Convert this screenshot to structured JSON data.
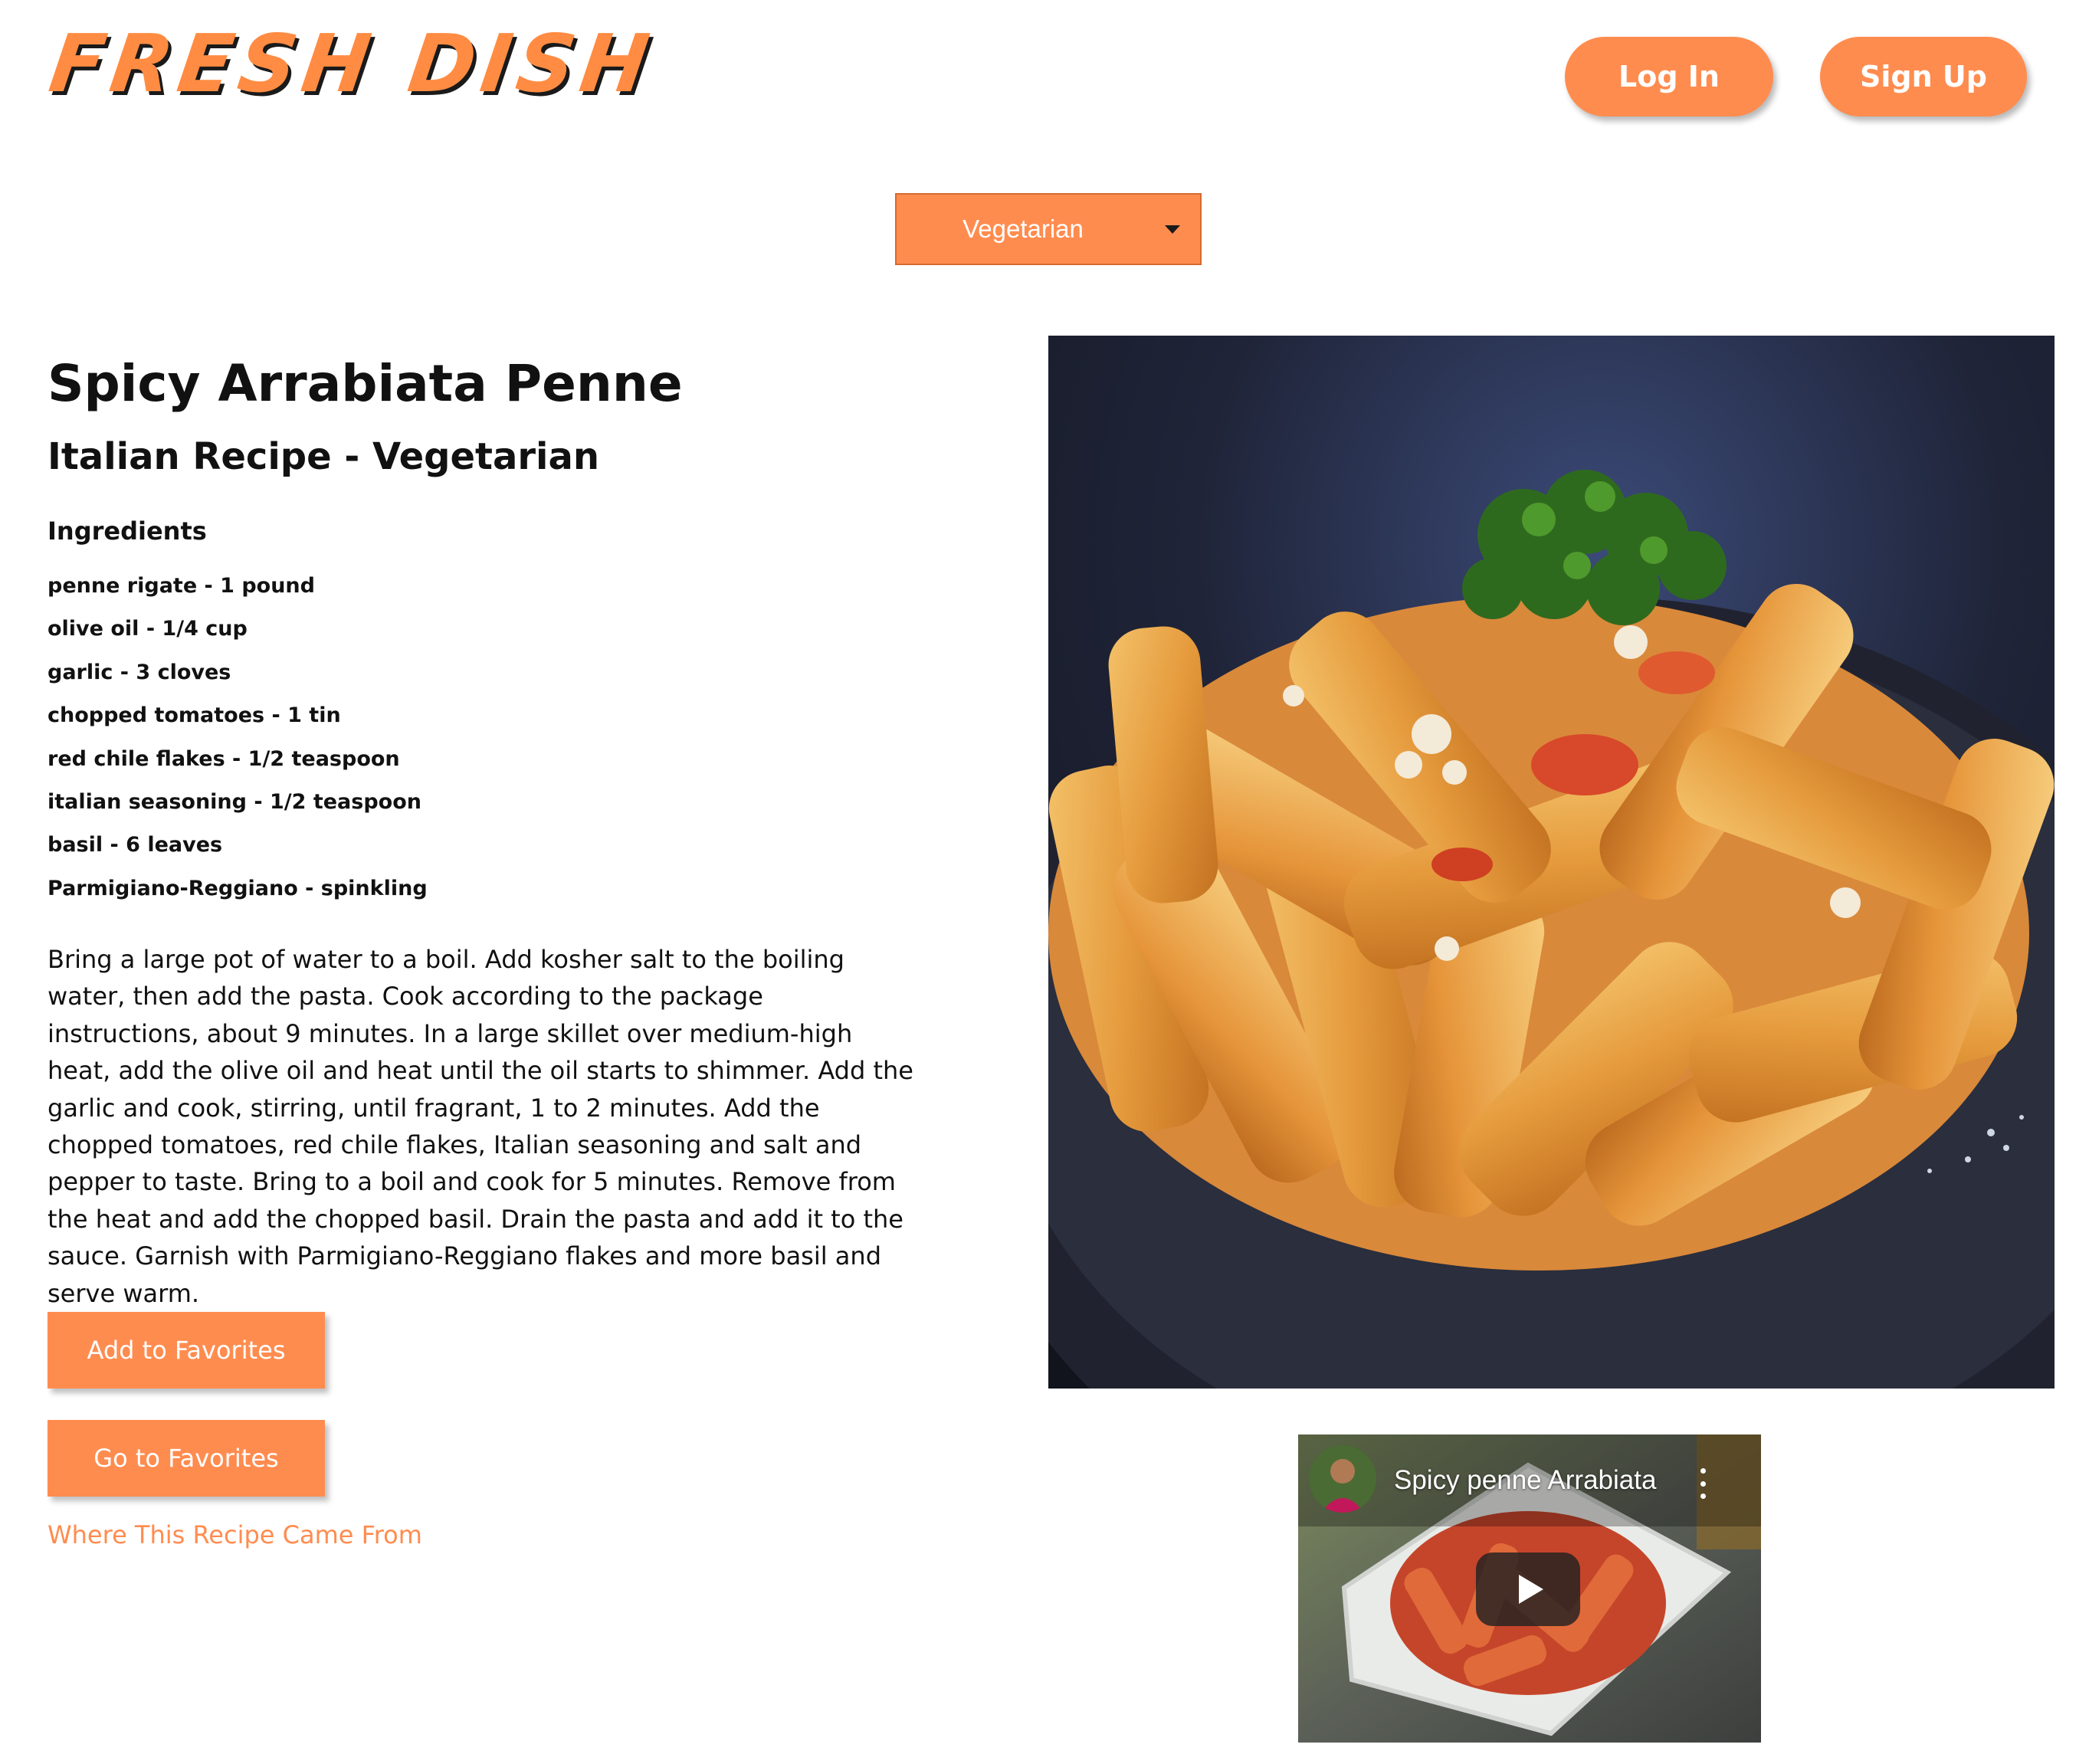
{
  "header": {
    "logo_text": "FRESH DISH",
    "login_label": "Log In",
    "signup_label": "Sign Up"
  },
  "filter": {
    "selected": "Vegetarian"
  },
  "recipe": {
    "title": "Spicy Arrabiata Penne",
    "subtitle": "Italian Recipe - Vegetarian",
    "ingredients_heading": "Ingredients",
    "ingredients": [
      "penne rigate - 1 pound",
      "olive oil - 1/4 cup",
      "garlic - 3 cloves",
      "chopped tomatoes - 1 tin",
      "red chile flakes - 1/2 teaspoon",
      "italian seasoning - 1/2 teaspoon",
      "basil - 6 leaves",
      "Parmigiano-Reggiano - spinkling"
    ],
    "instructions": "Bring a large pot of water to a boil. Add kosher salt to the boiling water, then add the pasta. Cook according to the package instructions, about 9 minutes. In a large skillet over medium-high heat, add the olive oil and heat until the oil starts to shimmer. Add the garlic and cook, stirring, until fragrant, 1 to 2 minutes. Add the chopped tomatoes, red chile flakes, Italian seasoning and salt and pepper to taste. Bring to a boil and cook for 5 minutes. Remove from the heat and add the chopped basil. Drain the pasta and add it to the sauce. Garnish with Parmigiano-Reggiano flakes and more basil and serve warm."
  },
  "actions": {
    "add_favorites_label": "Add to Favorites",
    "go_favorites_label": "Go to Favorites",
    "source_link_label": "Where This Recipe Came From"
  },
  "video": {
    "title": "Spicy penne Arrabiata"
  },
  "theme": {
    "accent": "#ff8c4f",
    "text": "#111111",
    "background": "#ffffff"
  }
}
